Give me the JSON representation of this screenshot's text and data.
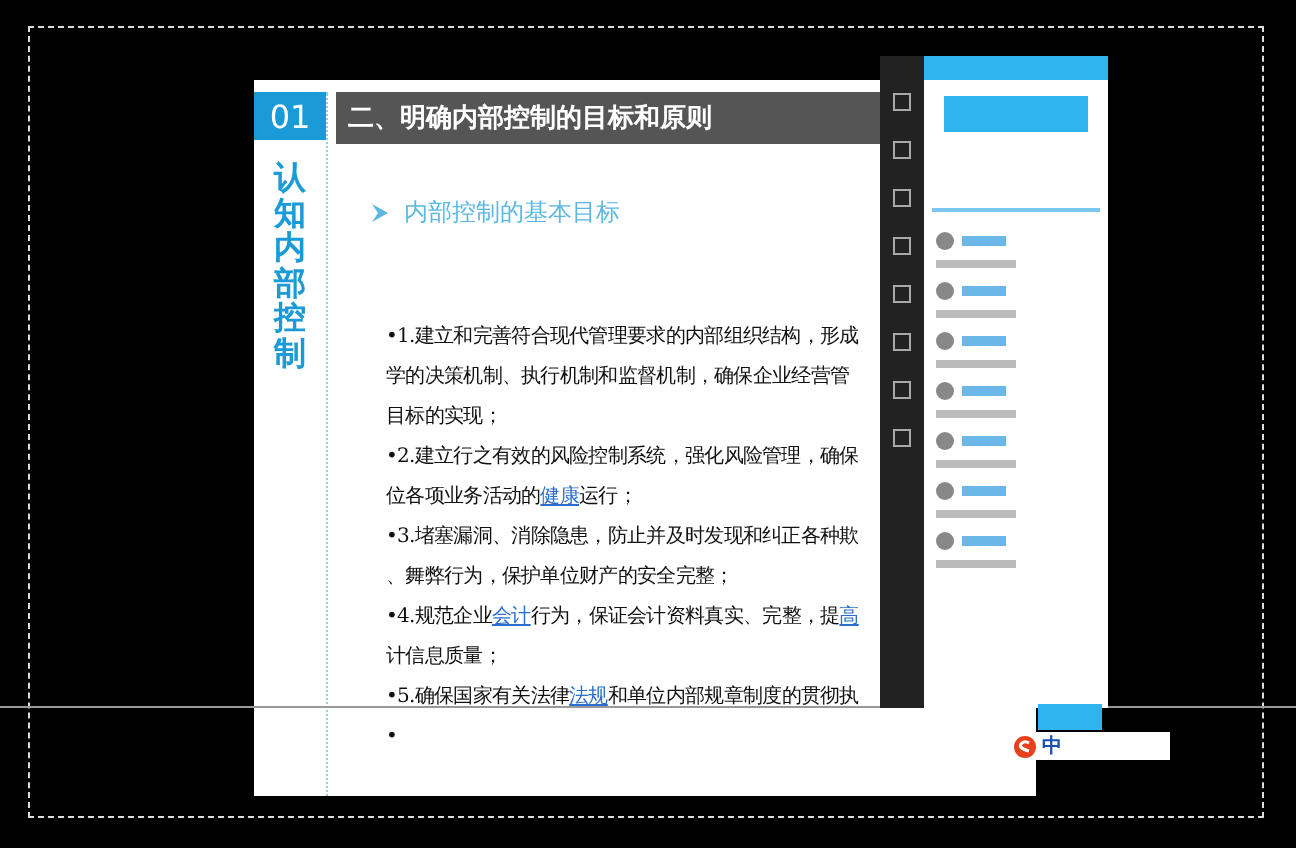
{
  "slide": {
    "section_number": "01",
    "title": "二、明确内部控制的目标和原则",
    "vertical_title": "认知内部控制",
    "subtitle": "内部控制的基本目标",
    "content_lines": [
      {
        "segments": [
          {
            "text": "•1.建立和完善符合现代管理要求的内部组织结构，形成",
            "link": false
          }
        ]
      },
      {
        "segments": [
          {
            "text": "学的决策机制、执行机制和监督机制，确保企业经营管",
            "link": false
          }
        ]
      },
      {
        "segments": [
          {
            "text": "目标的实现；",
            "link": false
          }
        ]
      },
      {
        "segments": [
          {
            "text": "•2.建立行之有效的风险控制系统，强化风险管理，确保",
            "link": false
          }
        ]
      },
      {
        "segments": [
          {
            "text": "位各项业务活动的",
            "link": false
          },
          {
            "text": "健康",
            "link": true
          },
          {
            "text": "运行；",
            "link": false
          }
        ]
      },
      {
        "segments": [
          {
            "text": "•3.堵塞漏洞、消除隐患，防止并及时发现和纠正各种欺",
            "link": false
          }
        ]
      },
      {
        "segments": [
          {
            "text": "、舞弊行为，保护单位财产的安全完整；",
            "link": false
          }
        ]
      },
      {
        "segments": [
          {
            "text": "•4.规范企业",
            "link": false
          },
          {
            "text": "会计",
            "link": true
          },
          {
            "text": "行为，保证会计资料真实、完整，提",
            "link": false
          },
          {
            "text": "高",
            "link": true
          }
        ]
      },
      {
        "segments": [
          {
            "text": "计信息质量；",
            "link": false
          }
        ]
      },
      {
        "segments": [
          {
            "text": "•5.确保国家有关法律",
            "link": false
          },
          {
            "text": "法规",
            "link": true
          },
          {
            "text": "和单位内部规章制度的贯彻执",
            "link": false
          }
        ]
      },
      {
        "segments": [
          {
            "text": "•",
            "link": false
          }
        ]
      }
    ]
  },
  "ime_bar": {
    "mode": "中"
  }
}
